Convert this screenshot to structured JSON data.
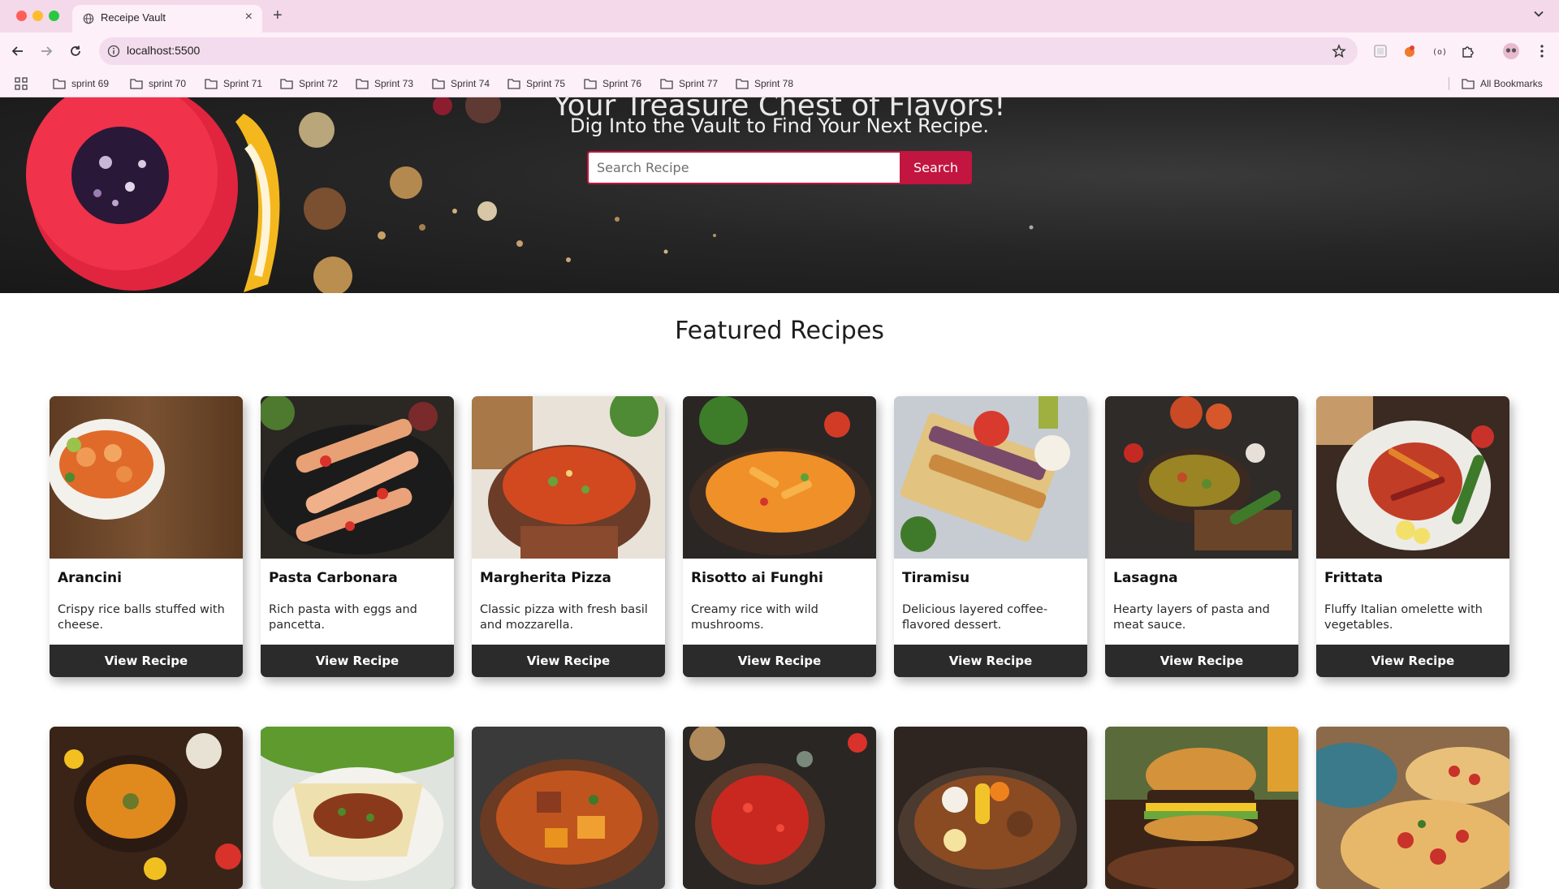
{
  "browser": {
    "tab_title": "Receipe Vault",
    "new_tab": "+",
    "close": "×",
    "url": "localhost:5500",
    "bookmarks": [
      "sprint 69",
      "sprint 70",
      "Sprint 71",
      "Sprint 72",
      "Sprint 73",
      "Sprint 74",
      "Sprint 75",
      "Sprint 76",
      "Sprint 77",
      "Sprint 78"
    ],
    "all_bookmarks": "All Bookmarks"
  },
  "hero": {
    "title": "Your Treasure Chest of Flavors!",
    "subtitle": "Dig Into the Vault to Find Your Next Recipe.",
    "search_placeholder": "Search Recipe",
    "search_button": "Search"
  },
  "featured": {
    "title": "Featured Recipes",
    "button_label": "View Recipe",
    "recipes": [
      {
        "name": "Arancini",
        "desc": "Crispy rice balls stuffed with cheese."
      },
      {
        "name": "Pasta Carbonara",
        "desc": "Rich pasta with eggs and pancetta."
      },
      {
        "name": "Margherita Pizza",
        "desc": "Classic pizza with fresh basil and mozzarella."
      },
      {
        "name": "Risotto ai Funghi",
        "desc": "Creamy rice with wild mushrooms."
      },
      {
        "name": "Tiramisu",
        "desc": "Delicious layered coffee-flavored dessert."
      },
      {
        "name": "Lasagna",
        "desc": "Hearty layers of pasta and meat sauce."
      },
      {
        "name": "Frittata",
        "desc": "Fluffy Italian omelette with vegetables."
      }
    ]
  },
  "colors": {
    "accent": "#c2153f",
    "button_dark": "#2b2b2b",
    "tabbar": "#f3d9ea"
  }
}
